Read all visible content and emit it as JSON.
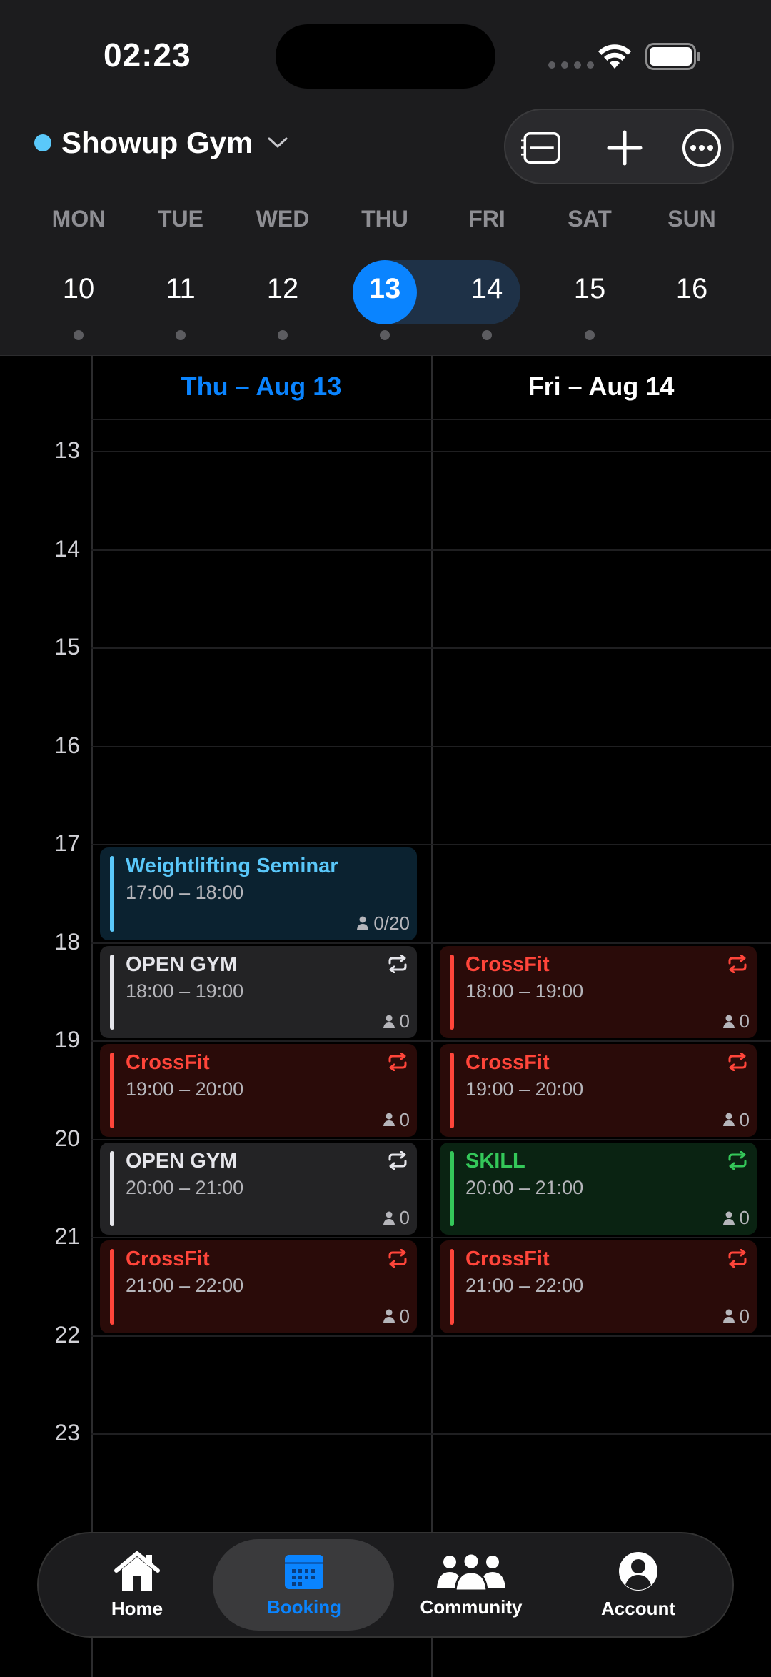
{
  "status": {
    "time": "02:23"
  },
  "header": {
    "gym_name": "Showup Gym",
    "gym_dot_color": "#5AC8FA",
    "toolbar": [
      "list-icon",
      "plus-icon",
      "more-icon"
    ]
  },
  "week": {
    "days": [
      {
        "label": "MON",
        "date": "10",
        "has_events": true
      },
      {
        "label": "TUE",
        "date": "11",
        "has_events": true
      },
      {
        "label": "WED",
        "date": "12",
        "has_events": true
      },
      {
        "label": "THU",
        "date": "13",
        "has_events": true,
        "selected": true
      },
      {
        "label": "FRI",
        "date": "14",
        "has_events": true
      },
      {
        "label": "SAT",
        "date": "15",
        "has_events": true
      },
      {
        "label": "SUN",
        "date": "16",
        "has_events": false
      }
    ]
  },
  "calendar": {
    "columns": [
      {
        "title": "Thu – Aug 13",
        "highlight": true
      },
      {
        "title": "Fri – Aug 14",
        "highlight": false
      }
    ],
    "hours": [
      "13",
      "14",
      "15",
      "16",
      "17",
      "18",
      "19",
      "20",
      "21",
      "22",
      "23"
    ],
    "events": [
      {
        "col": 0,
        "start": 17,
        "end": 18,
        "title": "Weightlifting Seminar",
        "time": "17:00 – 18:00",
        "count": "0/20",
        "color": "blue",
        "recurring": false
      },
      {
        "col": 0,
        "start": 18,
        "end": 19,
        "title": "OPEN GYM",
        "time": "18:00 – 19:00",
        "count": "0",
        "color": "gray",
        "recurring": true
      },
      {
        "col": 0,
        "start": 19,
        "end": 20,
        "title": "CrossFit",
        "time": "19:00 – 20:00",
        "count": "0",
        "color": "red",
        "recurring": true
      },
      {
        "col": 0,
        "start": 20,
        "end": 21,
        "title": "OPEN GYM",
        "time": "20:00 – 21:00",
        "count": "0",
        "color": "gray",
        "recurring": true
      },
      {
        "col": 0,
        "start": 21,
        "end": 22,
        "title": "CrossFit",
        "time": "21:00 – 22:00",
        "count": "0",
        "color": "red",
        "recurring": true
      },
      {
        "col": 1,
        "start": 18,
        "end": 19,
        "title": "CrossFit",
        "time": "18:00 – 19:00",
        "count": "0",
        "color": "red",
        "recurring": true
      },
      {
        "col": 1,
        "start": 19,
        "end": 20,
        "title": "CrossFit",
        "time": "19:00 – 20:00",
        "count": "0",
        "color": "red",
        "recurring": true
      },
      {
        "col": 1,
        "start": 20,
        "end": 21,
        "title": "SKILL",
        "time": "20:00 – 21:00",
        "count": "0",
        "color": "green",
        "recurring": true
      },
      {
        "col": 1,
        "start": 21,
        "end": 22,
        "title": "CrossFit",
        "time": "21:00 – 22:00",
        "count": "0",
        "color": "red",
        "recurring": true
      }
    ]
  },
  "colors": {
    "blue": "#5AC8FA",
    "gray": "#E5E5EA",
    "red": "#FF453A",
    "green": "#34C759",
    "accent": "#0A84FF"
  },
  "tabs": [
    {
      "label": "Home",
      "icon": "home-icon",
      "active": false
    },
    {
      "label": "Booking",
      "icon": "calendar-icon",
      "active": true
    },
    {
      "label": "Community",
      "icon": "community-icon",
      "active": false
    },
    {
      "label": "Account",
      "icon": "account-icon",
      "active": false
    }
  ]
}
